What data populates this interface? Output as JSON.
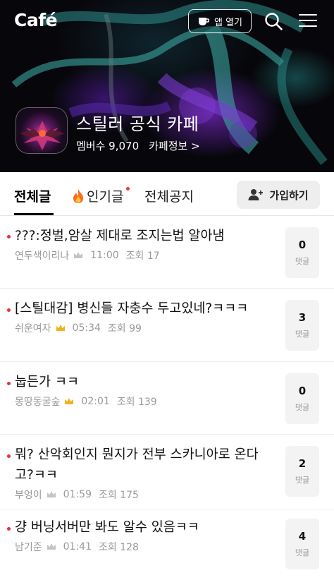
{
  "header": {
    "logo": "Café",
    "app_open_label": "앱 열기",
    "cafe_name": "스틸러 공식 카페",
    "member_label": "멤버수 9,070",
    "cafe_info_label": "카페정보 >"
  },
  "tabs": [
    {
      "label": "전체글",
      "active": true
    },
    {
      "label": "인기글",
      "active": false,
      "has_new": true
    },
    {
      "label": "전체공지",
      "active": false
    }
  ],
  "join_button": {
    "label": "가입하기"
  },
  "posts": [
    {
      "title": "???:정벌,암살 제대로 조지는법 알아냄",
      "author": "연두색이리나",
      "crown": "silver",
      "time": "11:00",
      "views": "조회 17",
      "comments": "0",
      "comment_label": "댓글"
    },
    {
      "title": "[스틸대감] 병신들 자충수 두고있네?ㅋㅋㅋ",
      "author": "쉬운여자",
      "crown": "gold",
      "time": "05:34",
      "views": "조회 99",
      "comments": "3",
      "comment_label": "댓글"
    },
    {
      "title": "눕든가 ㅋㅋ",
      "author": "몽땅동굴숲",
      "crown": "gold",
      "time": "02:01",
      "views": "조회 139",
      "comments": "0",
      "comment_label": "댓글"
    },
    {
      "title": "뭐? 산악회인지 뭔지가 전부 스카니아로 온다고?ㅋㅋ",
      "author": "부엉이",
      "crown": "silver",
      "time": "01:59",
      "views": "조회 175",
      "comments": "2",
      "comment_label": "댓글"
    },
    {
      "title": "걍 버닝서버만 봐도 알수 있음ㅋㅋ",
      "author": "남기준",
      "crown": "silver",
      "time": "01:41",
      "views": "조회 128",
      "comments": "4",
      "comment_label": "댓글"
    }
  ],
  "colors": {
    "accent_red": "#e8322f",
    "crown_gold": "#f2b21c",
    "crown_silver": "#c4c4c4"
  }
}
